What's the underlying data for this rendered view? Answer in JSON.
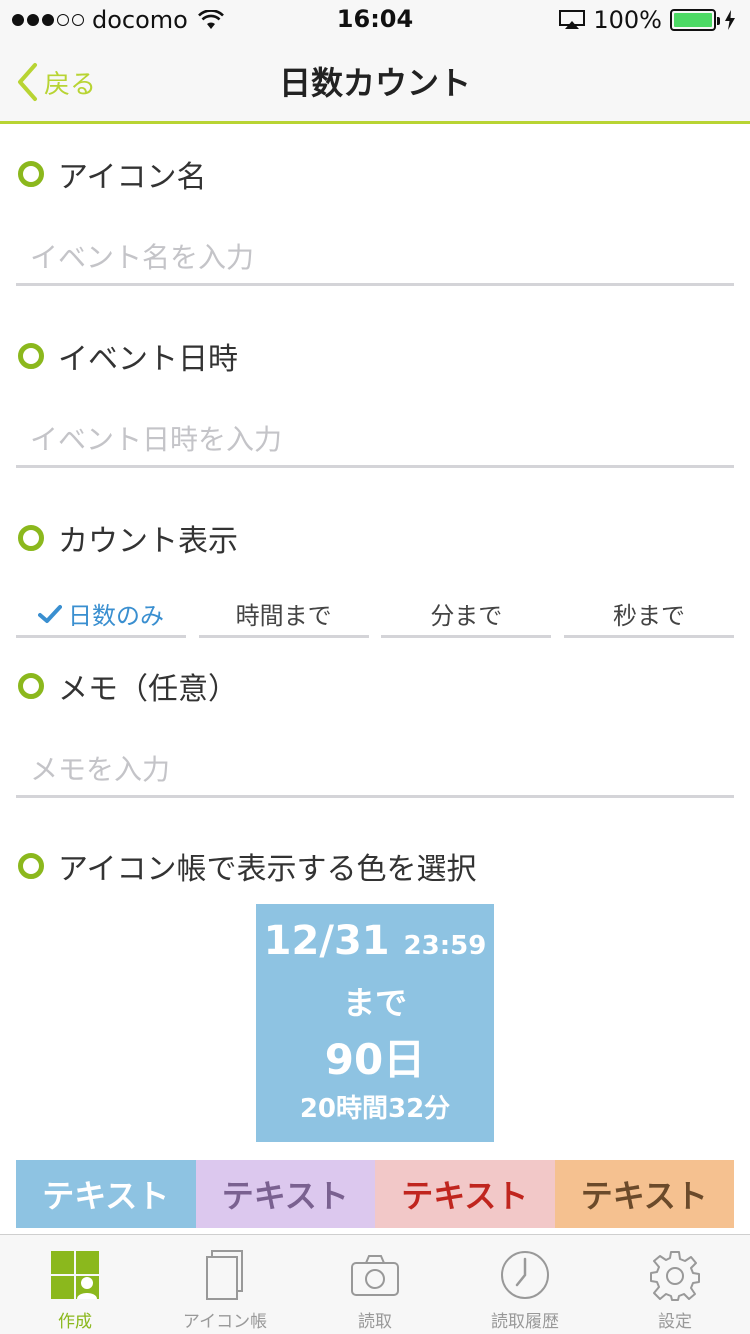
{
  "status_bar": {
    "carrier": "docomo",
    "time": "16:04",
    "battery": "100%",
    "signal_icon": "signal-dots-icon",
    "wifi_icon": "wifi-icon",
    "airplay_icon": "airplay-icon",
    "battery_icon": "battery-icon",
    "charging_icon": "bolt-icon"
  },
  "nav": {
    "back_label": "戻る",
    "title": "日数カウント",
    "accent": "#b8d433"
  },
  "sections": {
    "icon_name": {
      "label": "アイコン名",
      "placeholder": "イベント名を入力"
    },
    "event_datetime": {
      "label": "イベント日時",
      "placeholder": "イベント日時を入力"
    },
    "count_display": {
      "label": "カウント表示",
      "options": [
        "日数のみ",
        "時間まで",
        "分まで",
        "秒まで"
      ],
      "selected": "日数のみ"
    },
    "memo": {
      "label": "メモ（任意）",
      "placeholder": "メモを入力"
    },
    "color_select": {
      "label": "アイコン帳で表示する色を選択"
    }
  },
  "preview": {
    "date": "12/31",
    "time": "23:59",
    "until": "まで",
    "days": "90日",
    "remaining": "20時間32分",
    "bg_color": "#8ec3e2"
  },
  "colors": [
    {
      "label": "テキスト",
      "bg": "#8ec3e2",
      "text": "#ffffff"
    },
    {
      "label": "テキスト",
      "bg": "#dcc8ee",
      "text": "#7a6190"
    },
    {
      "label": "テキスト",
      "bg": "#f2c8c8",
      "text": "#c0251e"
    },
    {
      "label": "テキスト",
      "bg": "#f5c190",
      "text": "#6b4a2a"
    }
  ],
  "tabs": [
    {
      "label": "作成",
      "icon": "create-grid-icon",
      "active": true
    },
    {
      "label": "アイコン帳",
      "icon": "notebook-icon",
      "active": false
    },
    {
      "label": "読取",
      "icon": "camera-icon",
      "active": false
    },
    {
      "label": "読取履歴",
      "icon": "clock-icon",
      "active": false
    },
    {
      "label": "設定",
      "icon": "gear-icon",
      "active": false
    }
  ]
}
